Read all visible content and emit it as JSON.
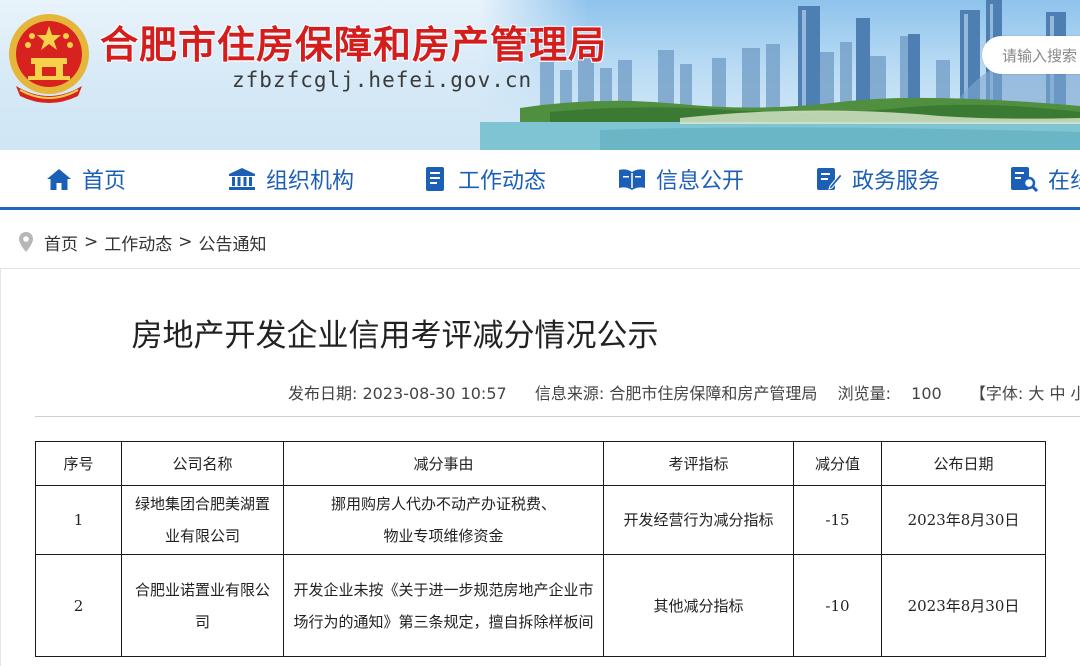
{
  "header": {
    "site_title": "合肥市住房保障和房产管理局",
    "site_domain": "zfbzfcglj.hefei.gov.cn",
    "search_placeholder": "请输入搜索"
  },
  "nav": {
    "items": [
      {
        "label": "首页",
        "icon": "home-icon"
      },
      {
        "label": "组织机构",
        "icon": "institution-icon"
      },
      {
        "label": "工作动态",
        "icon": "document-icon"
      },
      {
        "label": "信息公开",
        "icon": "open-book-icon"
      },
      {
        "label": "政务服务",
        "icon": "edit-form-icon"
      },
      {
        "label": "在线",
        "icon": "search-document-icon"
      }
    ]
  },
  "breadcrumb": {
    "items": [
      "首页",
      "工作动态",
      "公告通知"
    ],
    "separator": ">"
  },
  "article": {
    "title": "房地产开发企业信用考评减分情况公示",
    "publish_date_label": "发布日期:",
    "publish_date": "2023-08-30 10:57",
    "source_label": "信息来源:",
    "source": "合肥市住房保障和房产管理局",
    "views_label": "浏览量:",
    "views": "100",
    "font_size_control": "【字体: 大 中 小】"
  },
  "table": {
    "headers": [
      "序号",
      "公司名称",
      "减分事由",
      "考评指标",
      "减分值",
      "公布日期"
    ],
    "rows": [
      [
        "1",
        "绿地集团合肥美湖置业有限公司",
        "挪用购房人代办不动产办证税费、物业专项维修资金",
        "开发经营行为减分指标",
        "-15",
        "2023年8月30日"
      ],
      [
        "2",
        "合肥业诺置业有限公司",
        "开发企业未按《关于进一步规范房地产企业市场行为的通知》第三条规定，擅自拆除样板间",
        "其他减分指标",
        "-10",
        "2023年8月30日"
      ]
    ]
  },
  "colors": {
    "title_red": "#d41d1d",
    "nav_blue": "#1b5fb6",
    "nav_rule": "#1f68c2"
  }
}
